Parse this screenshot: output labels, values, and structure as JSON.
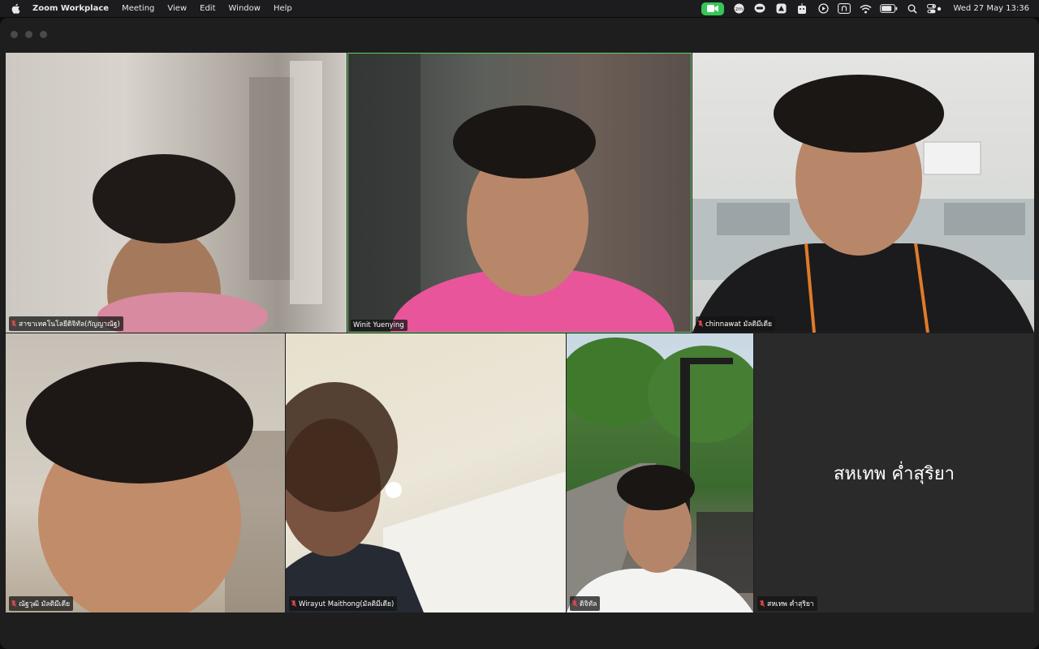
{
  "menubar": {
    "app": "Zoom Workplace",
    "items": [
      "Meeting",
      "View",
      "Edit",
      "Window",
      "Help"
    ],
    "datetime": "Wed 27 May  13:36",
    "status_icons": [
      "zoom-camera-icon",
      "app-icon",
      "line-icon",
      "drive-icon",
      "bot-icon",
      "play-icon",
      "input-source-icon",
      "wifi-icon",
      "battery-icon",
      "search-icon",
      "control-center-icon"
    ]
  },
  "participants": [
    {
      "name": "สาขาเทคโนโลยีดิจิทัล(กัญญาณัฐ)"
    },
    {
      "name": "Winit Yuenying"
    },
    {
      "name": "chinnawat มัลติมีเดีย"
    },
    {
      "name": "ณัฐวุฒิ มัลติมีเดีย"
    },
    {
      "name": "Wirayut Maithong(มัลติมีเดีย)"
    },
    {
      "name": "ดิจิทัล"
    },
    {
      "name": "สหเทพ ค่ำสุริยา",
      "display": "สหเทพ ค่ำสุริยา"
    }
  ],
  "colors": {
    "active_speaker": "#5fd068",
    "muted_mic": "#e5484d",
    "zoom_badge": "#35c759"
  }
}
